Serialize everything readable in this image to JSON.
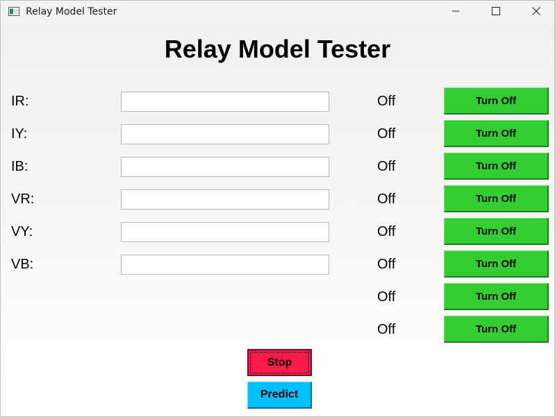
{
  "window": {
    "title": "Relay Model Tester"
  },
  "icons": {
    "app": "app-window-icon",
    "minimize": "minimize-icon",
    "maximize": "maximize-icon",
    "close": "close-icon"
  },
  "app": {
    "heading": "Relay Model Tester"
  },
  "inputs": [
    {
      "label": "IR:",
      "value": ""
    },
    {
      "label": "IY:",
      "value": ""
    },
    {
      "label": "IB:",
      "value": ""
    },
    {
      "label": "VR:",
      "value": ""
    },
    {
      "label": "VY:",
      "value": ""
    },
    {
      "label": "VB:",
      "value": ""
    }
  ],
  "relays": [
    {
      "status": "Off",
      "button": "Turn Off"
    },
    {
      "status": "Off",
      "button": "Turn Off"
    },
    {
      "status": "Off",
      "button": "Turn Off"
    },
    {
      "status": "Off",
      "button": "Turn Off"
    },
    {
      "status": "Off",
      "button": "Turn Off"
    },
    {
      "status": "Off",
      "button": "Turn Off"
    },
    {
      "status": "Off",
      "button": "Turn Off"
    },
    {
      "status": "Off",
      "button": "Turn Off"
    }
  ],
  "actions": {
    "stop": "Stop",
    "predict": "Predict"
  },
  "colors": {
    "toggle_button": "#32cd32",
    "stop_button": "#ff1a4a",
    "predict_button": "#00bfff"
  }
}
